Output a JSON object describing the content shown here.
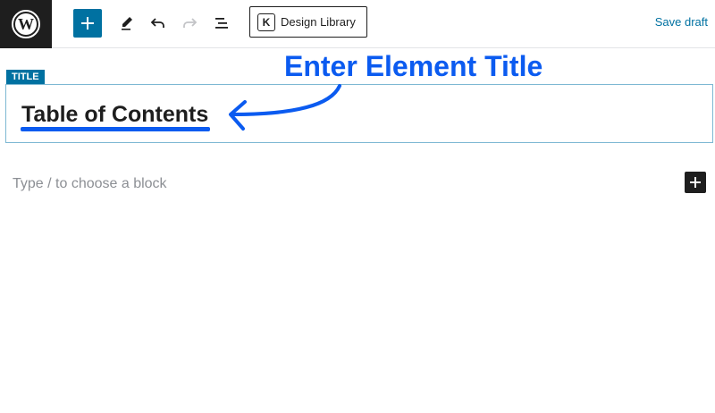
{
  "toolbar": {
    "logo_icon": "wordpress-logo-icon",
    "add_icon": "plus-icon",
    "tools_icon": "pencil-icon",
    "undo_icon": "undo-icon",
    "redo_icon": "redo-icon",
    "list_view_icon": "list-view-icon",
    "design_library_label": "Design Library",
    "design_library_icon": "kadence-icon",
    "save_draft_label": "Save draft"
  },
  "editor": {
    "title_badge": "TITLE",
    "post_title": "Table of Contents",
    "block_placeholder": "Type / to choose a block",
    "inserter_icon": "plus-icon"
  },
  "annotation": {
    "callout": "Enter Element Title"
  },
  "colors": {
    "accent": "#0071a1",
    "annotation_blue": "#0b5bf0",
    "dark": "#1e1e1e"
  }
}
